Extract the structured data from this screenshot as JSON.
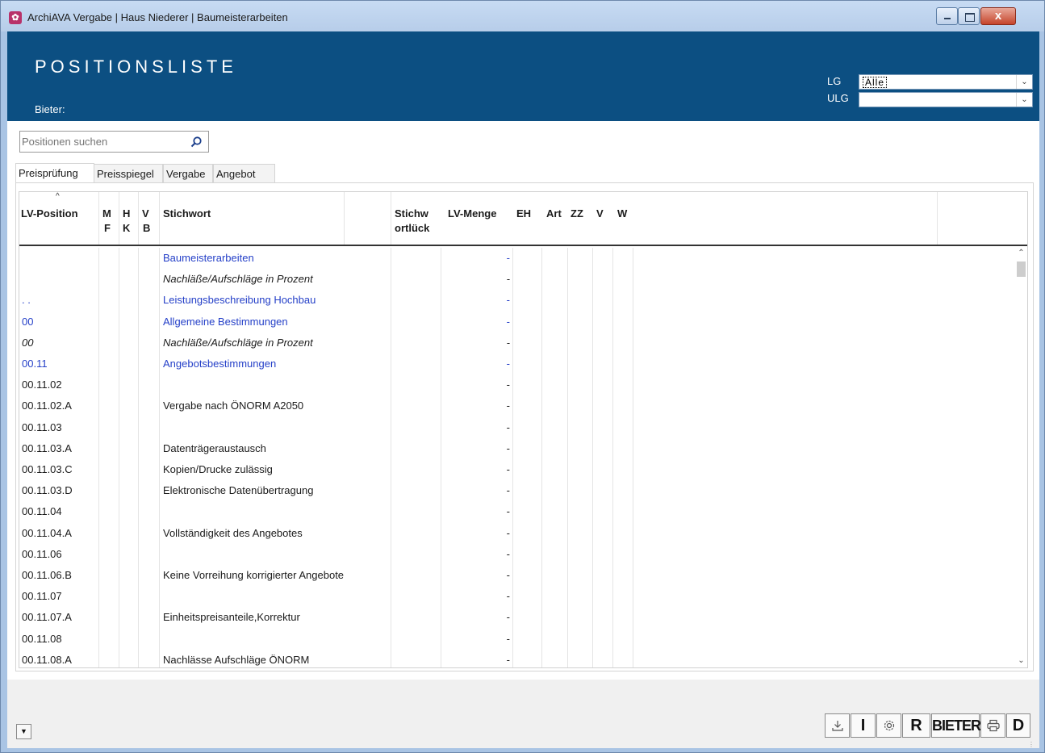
{
  "window": {
    "title": "ArchiAVA Vergabe | Haus Niederer | Baumeisterarbeiten",
    "icon": "archiava-app-icon",
    "close_label": "x"
  },
  "header": {
    "title": "POSITIONSLISTE",
    "bieter_label": "Bieter:",
    "lg_label": "LG",
    "lg_value": "Alle",
    "ulg_label": "ULG",
    "ulg_value": ""
  },
  "search": {
    "placeholder": "Positionen suchen"
  },
  "tabs": [
    {
      "label": "Preisprüfung",
      "active": true
    },
    {
      "label": "Preisspiegel",
      "active": false
    },
    {
      "label": "Vergabe",
      "active": false
    },
    {
      "label": "Angebot",
      "active": false
    }
  ],
  "grid": {
    "columns": {
      "lv_position": "LV-Position",
      "mf_top": "M",
      "mf_bottom": "F",
      "hk_top": "H",
      "hk_bottom": "K",
      "vb_top": "V",
      "vb_bottom": "B",
      "stichwort": "Stichwort",
      "stichwort_lueck_top": "Stichw",
      "stichwort_lueck_bottom": "ortlück",
      "lv_menge": "LV-Menge",
      "eh": "EH",
      "art": "Art",
      "zz": "ZZ",
      "v": "V",
      "w": "W"
    },
    "rows": [
      {
        "pos": "",
        "stichwort": "Baumeisterarbeiten",
        "menge": "-",
        "style": "link"
      },
      {
        "pos": "",
        "stichwort": "Nachläße/Aufschläge in Prozent",
        "menge": "-",
        "style": "italic"
      },
      {
        "pos": ". .",
        "stichwort": "Leistungsbeschreibung Hochbau",
        "menge": "-",
        "style": "link"
      },
      {
        "pos": "00",
        "stichwort": "Allgemeine Bestimmungen",
        "menge": "-",
        "style": "link"
      },
      {
        "pos": "00",
        "stichwort": "Nachläße/Aufschläge in Prozent",
        "menge": "-",
        "style": "italic"
      },
      {
        "pos": "00.11",
        "stichwort": "Angebotsbestimmungen",
        "menge": "-",
        "style": "link"
      },
      {
        "pos": "00.11.02",
        "stichwort": "",
        "menge": "-",
        "style": "normal"
      },
      {
        "pos": "00.11.02.A",
        "stichwort": "Vergabe nach ÖNORM A2050",
        "menge": "-",
        "style": "normal"
      },
      {
        "pos": "00.11.03",
        "stichwort": "",
        "menge": "-",
        "style": "normal"
      },
      {
        "pos": "00.11.03.A",
        "stichwort": "Datenträgeraustausch",
        "menge": "-",
        "style": "normal"
      },
      {
        "pos": "00.11.03.C",
        "stichwort": "Kopien/Drucke zulässig",
        "menge": "-",
        "style": "normal"
      },
      {
        "pos": "00.11.03.D",
        "stichwort": "Elektronische Datenübertragung",
        "menge": "-",
        "style": "normal"
      },
      {
        "pos": "00.11.04",
        "stichwort": "",
        "menge": "-",
        "style": "normal"
      },
      {
        "pos": "00.11.04.A",
        "stichwort": "Vollständigkeit des Angebotes",
        "menge": "-",
        "style": "normal"
      },
      {
        "pos": "00.11.06",
        "stichwort": "",
        "menge": "-",
        "style": "normal"
      },
      {
        "pos": "00.11.06.B",
        "stichwort": "Keine Vorreihung korrigierter Angebote",
        "menge": "-",
        "style": "normal"
      },
      {
        "pos": "00.11.07",
        "stichwort": "",
        "menge": "-",
        "style": "normal"
      },
      {
        "pos": "00.11.07.A",
        "stichwort": "Einheitspreisanteile,Korrektur",
        "menge": "-",
        "style": "normal"
      },
      {
        "pos": "00.11.08",
        "stichwort": "",
        "menge": "-",
        "style": "normal"
      },
      {
        "pos": "00.11.08.A",
        "stichwort": "Nachlässe Aufschläge ÖNORM",
        "menge": "-",
        "style": "normal"
      }
    ]
  },
  "footer": {
    "toolbar": {
      "download_icon": "download-icon",
      "i_label": "I",
      "settings_icon": "gear-icon",
      "r_label": "R",
      "bieter_label": "BIETER",
      "print_icon": "printer-icon",
      "d_label": "D"
    }
  },
  "colors": {
    "header_bg": "#0c4f82",
    "link": "#2540c8",
    "frame": "#a9c4e4"
  }
}
